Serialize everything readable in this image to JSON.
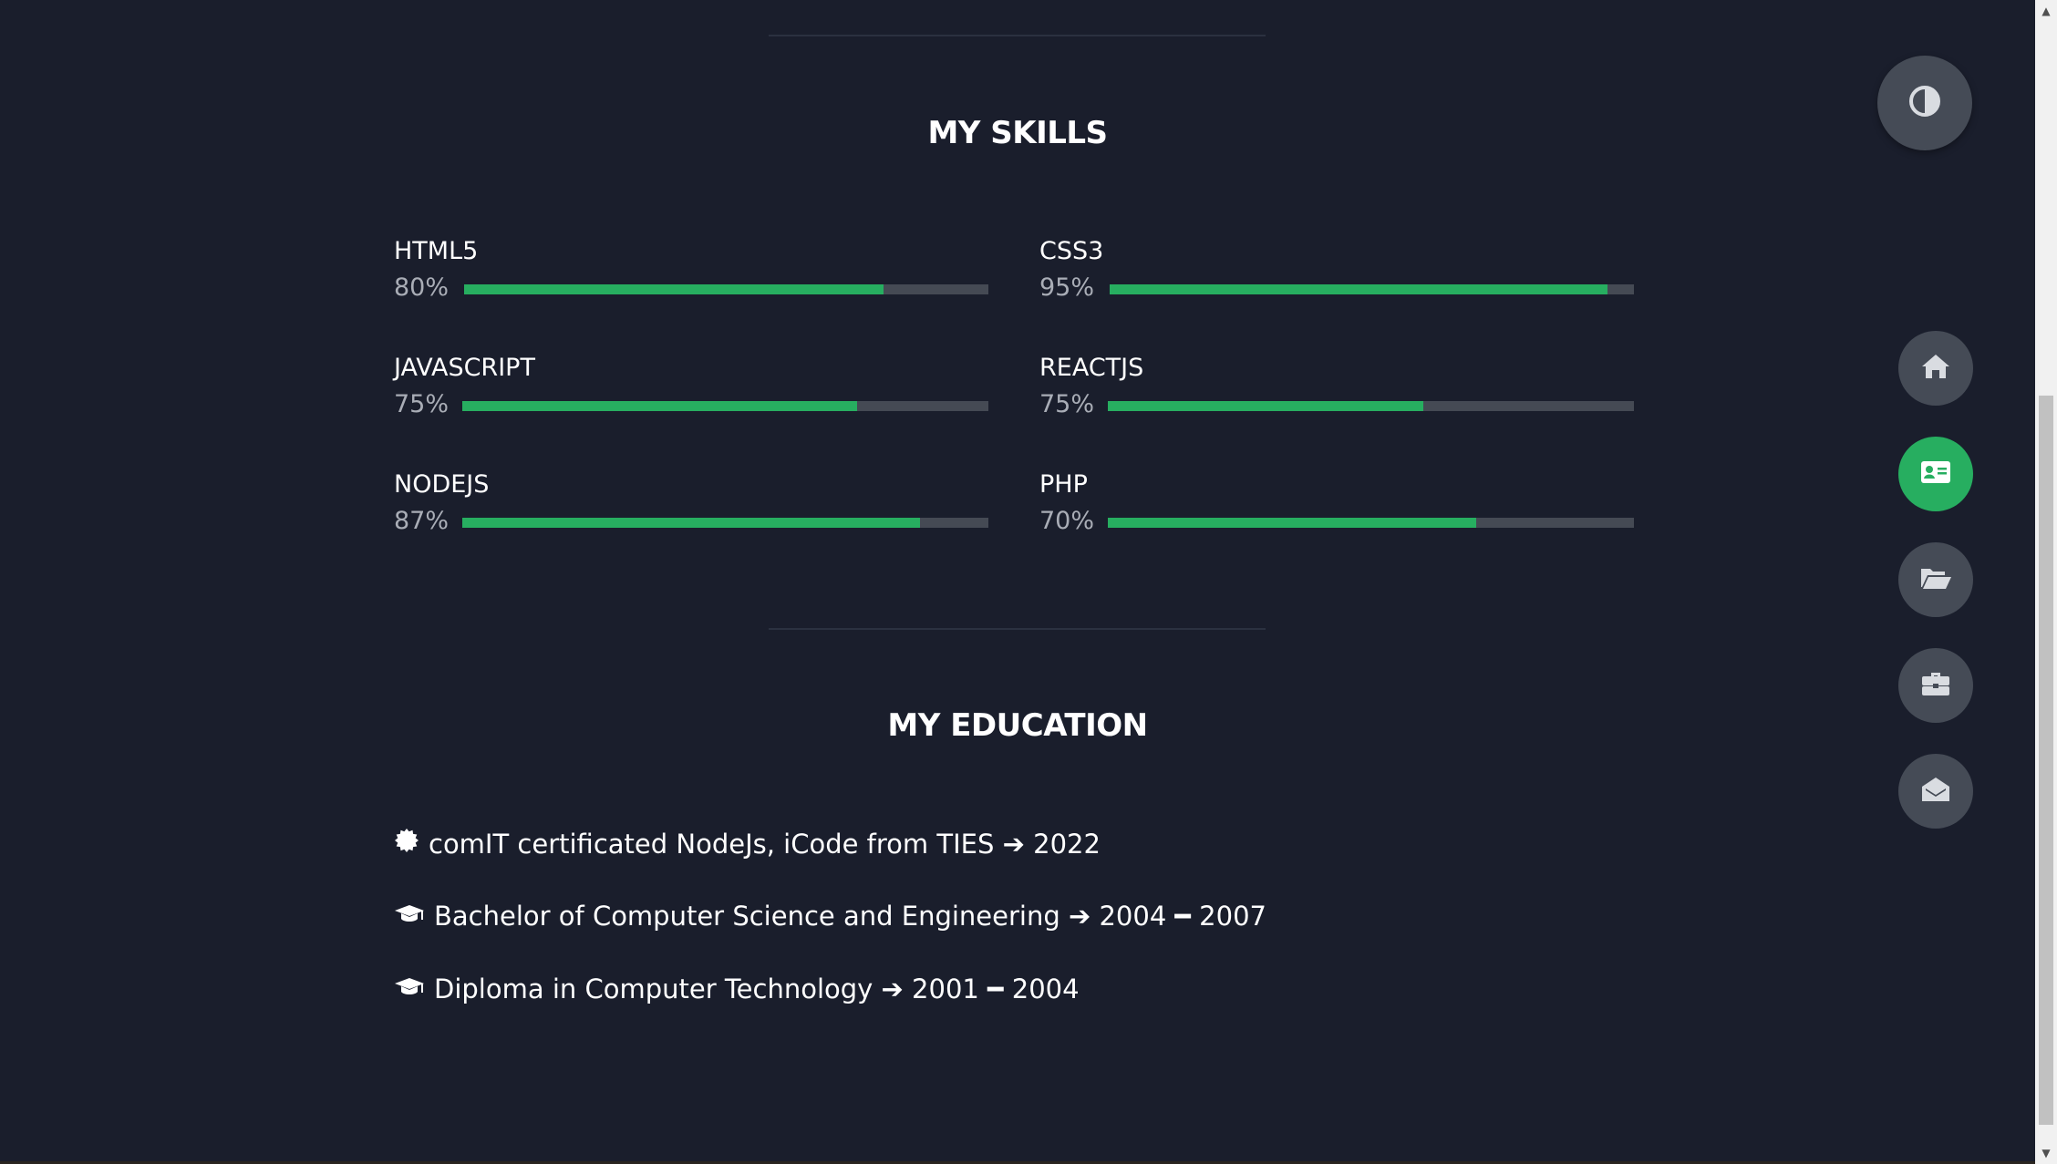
{
  "skills_section": {
    "title": "MY SKILLS",
    "items": [
      {
        "name": "HTML5",
        "percent_label": "80%",
        "fill": 0.8
      },
      {
        "name": "CSS3",
        "percent_label": "95%",
        "fill": 0.95
      },
      {
        "name": "JAVASCRIPT",
        "percent_label": "75%",
        "fill": 0.75
      },
      {
        "name": "REACTJS",
        "percent_label": "75%",
        "fill": 0.6
      },
      {
        "name": "NODEJS",
        "percent_label": "87%",
        "fill": 0.87
      },
      {
        "name": "PHP",
        "percent_label": "70%",
        "fill": 0.7
      }
    ]
  },
  "education_section": {
    "title": "MY EDUCATION",
    "items": [
      {
        "icon": "certificate-icon",
        "text": "comIT certificated NodeJs, iCode from TIES ➔ 2022"
      },
      {
        "icon": "graduation-cap-icon",
        "text": "Bachelor of Computer Science and Engineering ➔ 2004 ━ 2007"
      },
      {
        "icon": "graduation-cap-icon",
        "text": "Diploma in Computer Technology ➔ 2001 ━ 2004"
      }
    ]
  },
  "nav": {
    "theme_toggle_icon": "contrast-icon",
    "buttons": [
      {
        "icon": "home-icon",
        "active": false
      },
      {
        "icon": "id-card-icon",
        "active": true
      },
      {
        "icon": "folder-open-icon",
        "active": false
      },
      {
        "icon": "briefcase-icon",
        "active": false
      },
      {
        "icon": "envelope-open-icon",
        "active": false
      }
    ]
  },
  "colors": {
    "background": "#1a1e2c",
    "accent": "#27ae60",
    "track": "#454a54",
    "nav_button": "#454b56"
  }
}
